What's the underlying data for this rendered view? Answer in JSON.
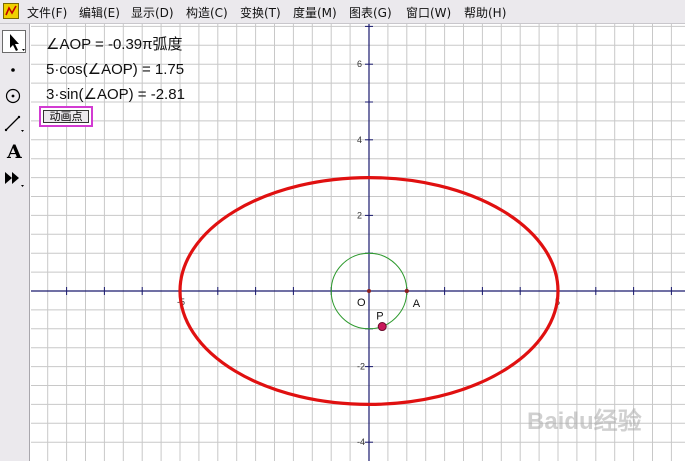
{
  "menubar": {
    "items": [
      "文件(F)",
      "编辑(E)",
      "显示(D)",
      "构造(C)",
      "变换(T)",
      "度量(M)",
      "图表(G)",
      "窗口(W)",
      "帮助(H)"
    ]
  },
  "toolbox": {
    "tools": [
      "select-arrow-tool",
      "point-tool",
      "compass-tool",
      "straightedge-tool",
      "text-tool",
      "custom-tool"
    ],
    "text_tool_glyph": "A",
    "selected_tool": "select-arrow-tool"
  },
  "measurements": {
    "angle": "∠AOP = -0.39π弧度",
    "cos": "5·cos(∠AOP) = 1.75",
    "sin": "3·sin(∠AOP) = -2.81"
  },
  "animate_button": {
    "label": "动画点"
  },
  "graph": {
    "x_tick_labels": [
      "-5",
      "5"
    ],
    "y_tick_labels": [
      "6",
      "4",
      "2",
      "-2",
      "-4"
    ],
    "origin_label": "O",
    "point_a_label": "A",
    "point_p_label": "P",
    "ellipse": {
      "a": 5,
      "b": 3,
      "color": "#e01010"
    },
    "unit_circle": {
      "r": 1,
      "color": "#2e9a2e"
    },
    "point_p": {
      "x": 0.35,
      "y": -0.94
    },
    "axis_color": "#1a1a6e",
    "grid_color": "#c8c8c8"
  },
  "watermark": "Baidu经验"
}
